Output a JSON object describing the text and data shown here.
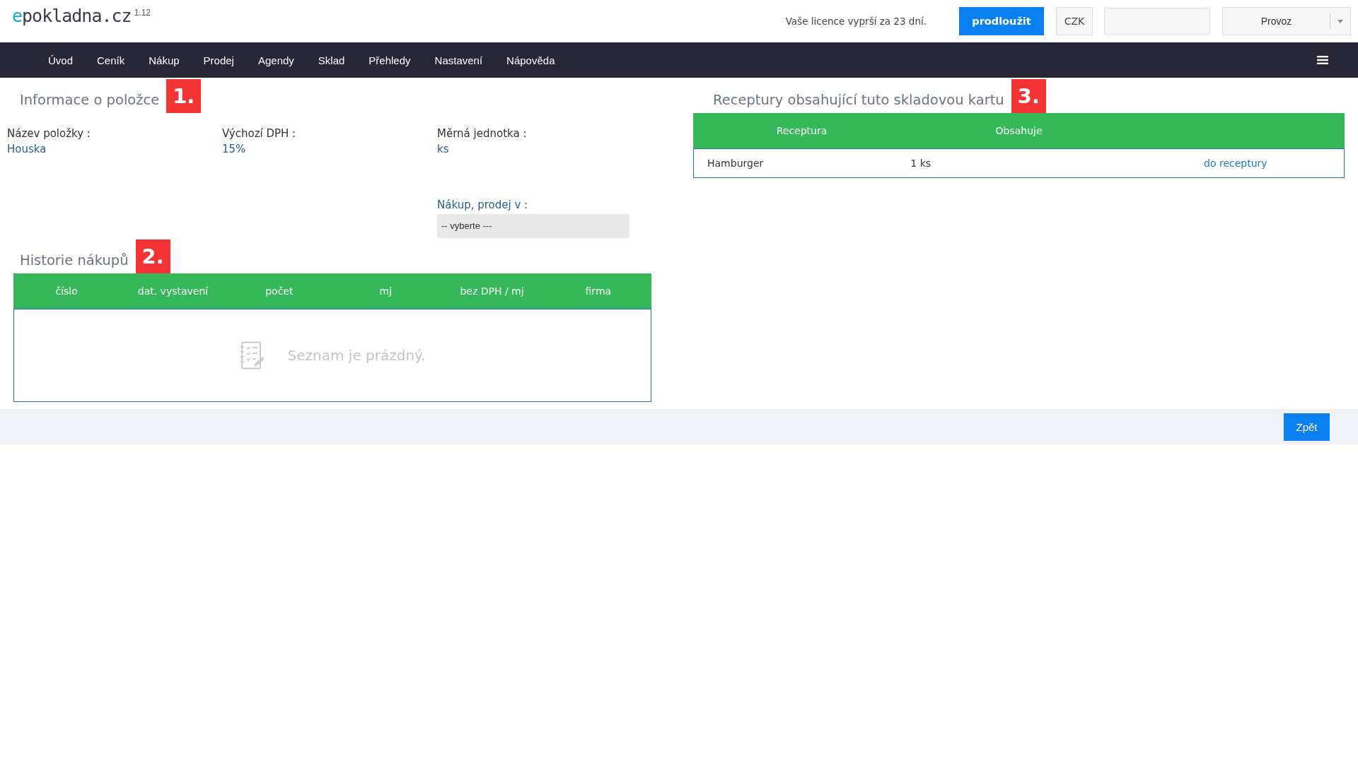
{
  "header": {
    "logo": "epokladna.cz",
    "version": "1.12",
    "license_notice": "Vaše licence vyprší za 23 dní.",
    "renew_button": "prodloužit",
    "currency_button": "CZK",
    "mode_select": "Provoz"
  },
  "nav": {
    "items": [
      "Úvod",
      "Ceník",
      "Nákup",
      "Prodej",
      "Agendy",
      "Sklad",
      "Přehledy",
      "Nastavení",
      "Nápověda"
    ]
  },
  "item_info": {
    "title": "Informace o položce",
    "badge": "1.",
    "fields": [
      {
        "label": "Název položky :",
        "value": "Houska"
      },
      {
        "label": "Výchozí DPH :",
        "value": "15%"
      },
      {
        "label": "Měrná jednotka :",
        "value": "ks"
      }
    ],
    "select": {
      "label": "Nákup, prodej v :",
      "value": "-- vyberte ---"
    }
  },
  "purchase_history": {
    "title": "Historie nákupů",
    "badge": "2.",
    "columns": [
      "číslo",
      "dat. vystavení",
      "počet",
      "mj",
      "bez DPH / mj",
      "firma"
    ],
    "empty_message": "Seznam je prázdný."
  },
  "recipes": {
    "title": "Receptury obsahující tuto skladovou kartu",
    "badge": "3.",
    "columns": [
      "Receptura",
      "Obsahuje"
    ],
    "rows": [
      {
        "recipe": "Hamburger",
        "contains": "1 ks",
        "link": "do receptury"
      }
    ]
  },
  "footer": {
    "back_button": "Zpět"
  }
}
